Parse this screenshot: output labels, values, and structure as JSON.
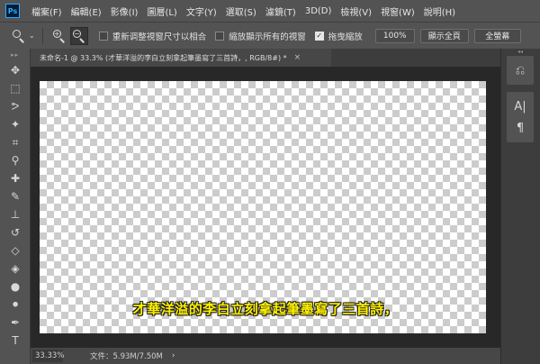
{
  "app": {
    "logo_text": "Ps"
  },
  "menu": [
    "檔案(F)",
    "編輯(E)",
    "影像(I)",
    "圖層(L)",
    "文字(Y)",
    "選取(S)",
    "濾鏡(T)",
    "3D(D)",
    "檢視(V)",
    "視窗(W)",
    "說明(H)"
  ],
  "options": {
    "resize_windows_label": "重新调整視窗尺寸以相合",
    "zoom_all_windows_label": "縮放顯示所有的視窗",
    "scrubby_zoom_label": "拖曳縮放",
    "btn_100_label": "100%",
    "btn_fit_label": "顯示全頁",
    "btn_fill_label": "全螢幕",
    "resize_windows_checked": false,
    "zoom_all_windows_checked": false,
    "scrubby_zoom_checked": true
  },
  "document": {
    "tab_title": "未命名-1 @ 33.3% (才華洋溢的李白立刻拿起筆墨寫了三首詩，, RGB/8#) *",
    "close_glyph": "×"
  },
  "canvas": {
    "subtitle": "才華洋溢的李白立刻拿起筆墨寫了三首詩，",
    "subtitle_color": "#fff200"
  },
  "status": {
    "zoom": "33.33%",
    "file_info": "文件：5.93M/7.50M",
    "arrow": "›"
  },
  "tools": [
    {
      "name": "move-tool-icon",
      "glyph": "✥"
    },
    {
      "name": "marquee-tool-icon",
      "glyph": "⬚"
    },
    {
      "name": "lasso-tool-icon",
      "glyph": "ᕗ"
    },
    {
      "name": "magic-wand-tool-icon",
      "glyph": "✦"
    },
    {
      "name": "crop-tool-icon",
      "glyph": "⌗"
    },
    {
      "name": "eyedropper-tool-icon",
      "glyph": "⚲"
    },
    {
      "name": "healing-brush-tool-icon",
      "glyph": "✚"
    },
    {
      "name": "brush-tool-icon",
      "glyph": "✎"
    },
    {
      "name": "clone-stamp-tool-icon",
      "glyph": "⊥"
    },
    {
      "name": "history-brush-tool-icon",
      "glyph": "↺"
    },
    {
      "name": "eraser-tool-icon",
      "glyph": "◇"
    },
    {
      "name": "paint-bucket-tool-icon",
      "glyph": "◈"
    },
    {
      "name": "blur-tool-icon",
      "glyph": "●"
    },
    {
      "name": "dodge-tool-icon",
      "glyph": "⚫"
    },
    {
      "name": "pen-tool-icon",
      "glyph": "✒"
    },
    {
      "name": "type-tool-icon",
      "glyph": "T"
    }
  ],
  "right_panel": {
    "history_glyph": "⎌",
    "character_glyph": "A|",
    "paragraph_glyph": "¶"
  }
}
